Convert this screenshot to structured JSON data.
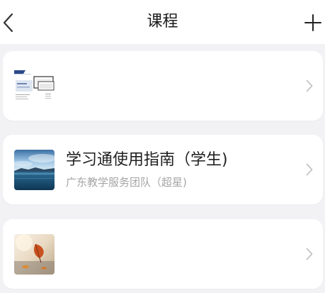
{
  "header": {
    "title": "课程",
    "back_icon": "chevron-left-icon",
    "add_icon": "plus-icon"
  },
  "courses": [
    {
      "name": "",
      "teacher": "",
      "thumbnail": "slide-document-thumbnail"
    },
    {
      "name": "学习通使用指南（学生)",
      "teacher": "广东教学服务团队（超星)",
      "thumbnail": "lake-landscape-thumbnail"
    },
    {
      "name": "",
      "teacher": "",
      "thumbnail": "autumn-leaf-thumbnail"
    }
  ],
  "colors": {
    "background": "#f2f2f5",
    "card": "#ffffff",
    "title_text": "#1a1a1a",
    "secondary_text": "#a5a5a5",
    "chevron": "#c4c4c4"
  }
}
